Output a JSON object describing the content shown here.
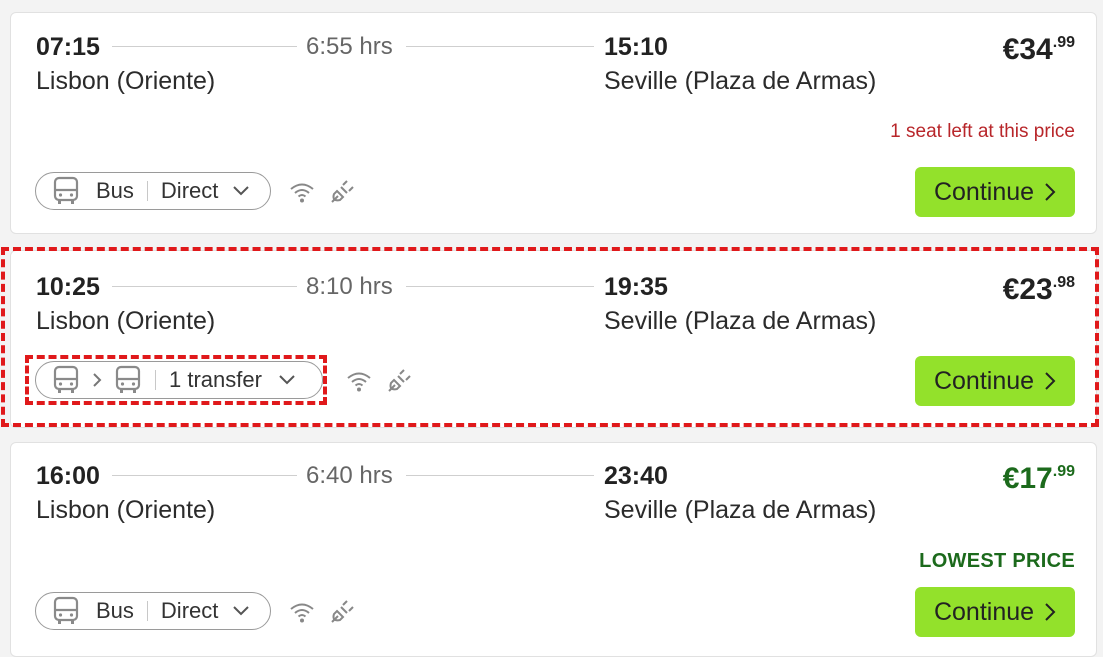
{
  "journeys": [
    {
      "departure_time": "07:15",
      "departure_station": "Lisbon (Oriente)",
      "duration": "6:55 hrs",
      "arrival_time": "15:10",
      "arrival_station": "Seville (Plaza de Armas)",
      "price_main": "€34",
      "price_cents": ".99",
      "note": "1 seat left at this price",
      "mode_label": "Bus",
      "route_label": "Direct",
      "continue_label": "Continue"
    },
    {
      "departure_time": "10:25",
      "departure_station": "Lisbon (Oriente)",
      "duration": "8:10 hrs",
      "arrival_time": "19:35",
      "arrival_station": "Seville (Plaza de Armas)",
      "price_main": "€23",
      "price_cents": ".98",
      "route_label": "1 transfer",
      "continue_label": "Continue"
    },
    {
      "departure_time": "16:00",
      "departure_station": "Lisbon (Oriente)",
      "duration": "6:40 hrs",
      "arrival_time": "23:40",
      "arrival_station": "Seville (Plaza de Armas)",
      "price_main": "€17",
      "price_cents": ".99",
      "note": "LOWEST PRICE",
      "mode_label": "Bus",
      "route_label": "Direct",
      "continue_label": "Continue"
    }
  ],
  "icons": {
    "bus": "bus-icon",
    "wifi": "wifi-icon",
    "power": "power-plug-icon",
    "chevron_down": "chevron-down-icon",
    "chevron_right": "chevron-right-icon"
  },
  "colors": {
    "continue_button": "#93e12b",
    "lowest_price_green": "#1c6a1c",
    "warning_red": "#b8262a",
    "highlight_red": "#e0191b"
  }
}
